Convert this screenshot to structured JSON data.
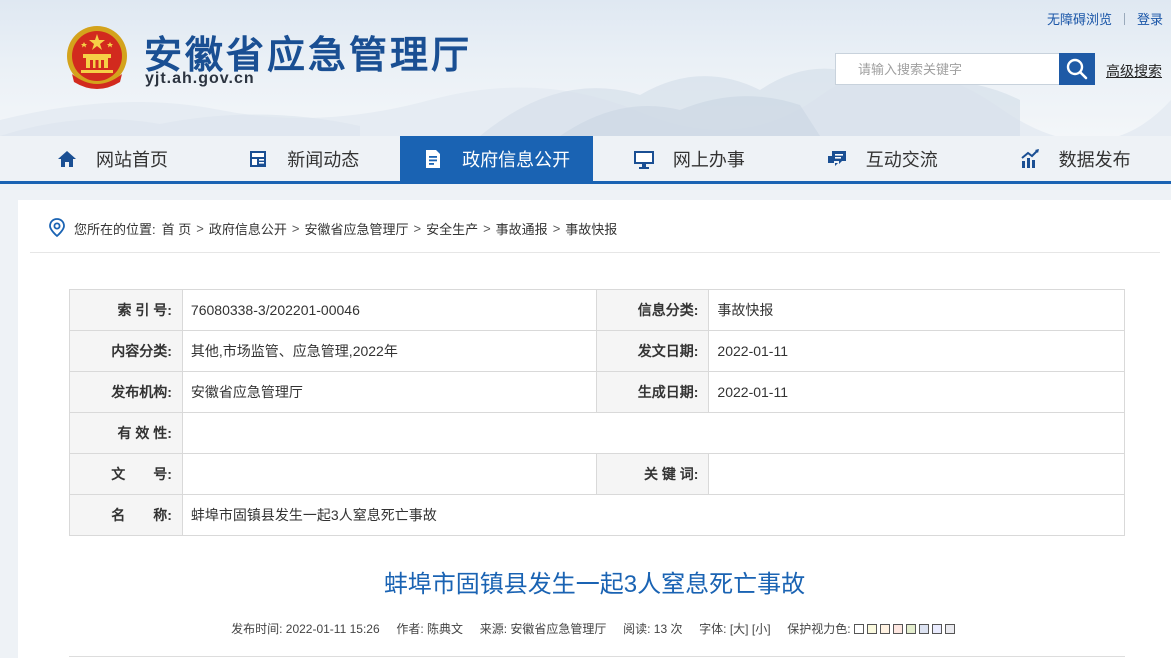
{
  "header": {
    "site_title": "安徽省应急管理厅",
    "site_domain": "yjt.ah.gov.cn",
    "top_links": {
      "accessibility": "无障碍浏览",
      "login": "登录"
    },
    "search": {
      "placeholder": "请输入搜索关键字",
      "value": "",
      "advanced": "高级搜索"
    },
    "emblem_icon": "national-emblem-icon"
  },
  "nav": {
    "items": [
      {
        "label": "网站首页",
        "icon": "home-icon"
      },
      {
        "label": "新闻动态",
        "icon": "news-icon"
      },
      {
        "label": "政府信息公开",
        "icon": "document-icon",
        "active": true
      },
      {
        "label": "网上办事",
        "icon": "monitor-icon"
      },
      {
        "label": "互动交流",
        "icon": "chat-icon"
      },
      {
        "label": "数据发布",
        "icon": "chart-icon"
      }
    ],
    "accent_color": "#1a63b3"
  },
  "breadcrumb": {
    "prefix": "您所在的位置:",
    "items": [
      "首 页",
      "政府信息公开",
      "安徽省应急管理厅",
      "安全生产",
      "事故通报",
      "事故快报"
    ]
  },
  "info": {
    "index_label": "索 引 号:",
    "index_value": "76080338-3/202201-00046",
    "category_label": "信息分类:",
    "category_value": "事故快报",
    "content_label": "内容分类:",
    "content_value": "其他,市场监管、应急管理,2022年",
    "issue_date_label": "发文日期:",
    "issue_date_value": "2022-01-11",
    "publisher_label": "发布机构:",
    "publisher_value": "安徽省应急管理厅",
    "created_date_label": "生成日期:",
    "created_date_value": "2022-01-11",
    "validity_label": "有 效 性:",
    "validity_value": "",
    "doc_no_label": "文　　号:",
    "doc_no_value": "",
    "keywords_label": "关 键 词:",
    "keywords_value": "",
    "name_label": "名　　称:",
    "name_value": "蚌埠市固镇县发生一起3人窒息死亡事故"
  },
  "article": {
    "title": "蚌埠市固镇县发生一起3人窒息死亡事故",
    "meta": {
      "time_label": "发布时间:",
      "time": "2022-01-11 15:26",
      "author_label": "作者:",
      "author": "陈典文",
      "source_label": "来源:",
      "source": "安徽省应急管理厅",
      "views_label": "阅读:",
      "views": "13 次",
      "font_label": "字体:",
      "font_large": "[大]",
      "font_small": "[小]",
      "eye_label": "保护视力色:"
    },
    "eye_colors": [
      "#ffffff",
      "#faf9de",
      "#fff2e2",
      "#fde6e0",
      "#e3edcd",
      "#dce2f1",
      "#e9ebfe",
      "#eaeaef"
    ]
  }
}
